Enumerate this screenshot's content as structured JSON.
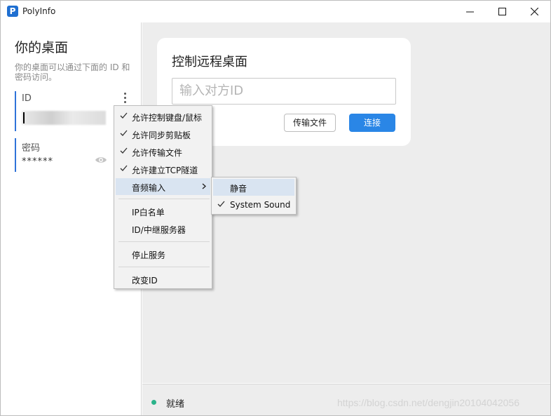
{
  "window": {
    "title": "PolyInfo",
    "logo_letter": "P"
  },
  "left": {
    "title": "你的桌面",
    "desc": "你的桌面可以通过下面的 ID 和密码访问。",
    "id_label": "ID",
    "password_label": "密码",
    "password_value": "******"
  },
  "remote": {
    "title": "控制远程桌面",
    "input_placeholder": "输入对方ID",
    "transfer_label": "传输文件",
    "connect_label": "连接"
  },
  "menu": {
    "items": [
      {
        "label": "允许控制键盘/鼠标",
        "checked": true
      },
      {
        "label": "允许同步剪贴板",
        "checked": true
      },
      {
        "label": "允许传输文件",
        "checked": true
      },
      {
        "label": "允许建立TCP隧道",
        "checked": true
      },
      {
        "label": "音频输入",
        "checked": false,
        "submenu": true
      },
      {
        "label": "IP白名单",
        "checked": false
      },
      {
        "label": "ID/中继服务器",
        "checked": false
      },
      {
        "label": "停止服务",
        "checked": false
      },
      {
        "label": "改变ID",
        "checked": false
      }
    ],
    "audio_submenu": [
      {
        "label": "静音",
        "checked": false
      },
      {
        "label": "System Sound",
        "checked": true
      }
    ]
  },
  "status": {
    "text": "就绪",
    "color": "#2bb38a"
  },
  "watermark": "https://blog.csdn.net/dengjin20104042056",
  "colors": {
    "accent": "#2a86e6",
    "field_marker": "#2f73d9"
  }
}
